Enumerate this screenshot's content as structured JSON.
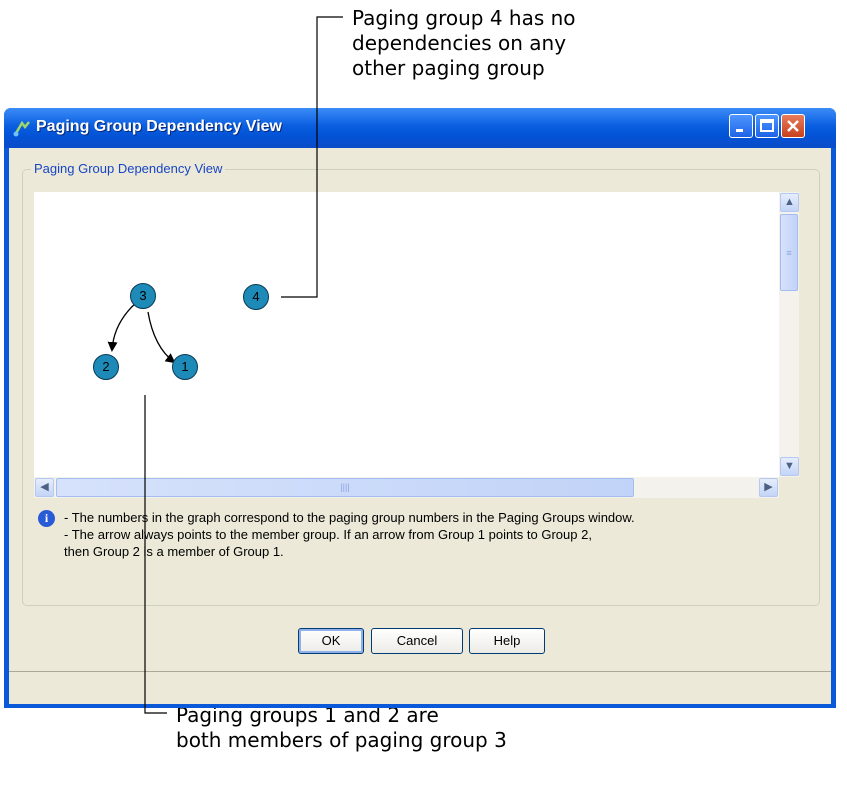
{
  "callouts": {
    "top": "Paging group 4 has no\ndependencies on any\nother paging group",
    "bottom": "Paging groups 1 and 2 are\nboth members of paging group 3"
  },
  "figure_id": "236188",
  "window": {
    "title": "Paging Group Dependency View",
    "groupbox_label": "Paging Group Dependency View"
  },
  "graph": {
    "nodes": [
      "3",
      "4",
      "2",
      "1"
    ]
  },
  "info": {
    "icon": "info-icon",
    "lines": [
      "- The numbers in the graph correspond to the paging group numbers in the Paging Groups window.",
      "- The arrow always points to the member group. If an arrow from Group 1 points to Group 2,",
      "then Group 2 is a member of Group 1."
    ]
  },
  "buttons": {
    "ok": "OK",
    "cancel": "Cancel",
    "help": "Help"
  },
  "colors": {
    "title_bar": "#0a59d9",
    "node_fill": "#1e8ab7",
    "dialog_bg": "#ece9d8"
  }
}
